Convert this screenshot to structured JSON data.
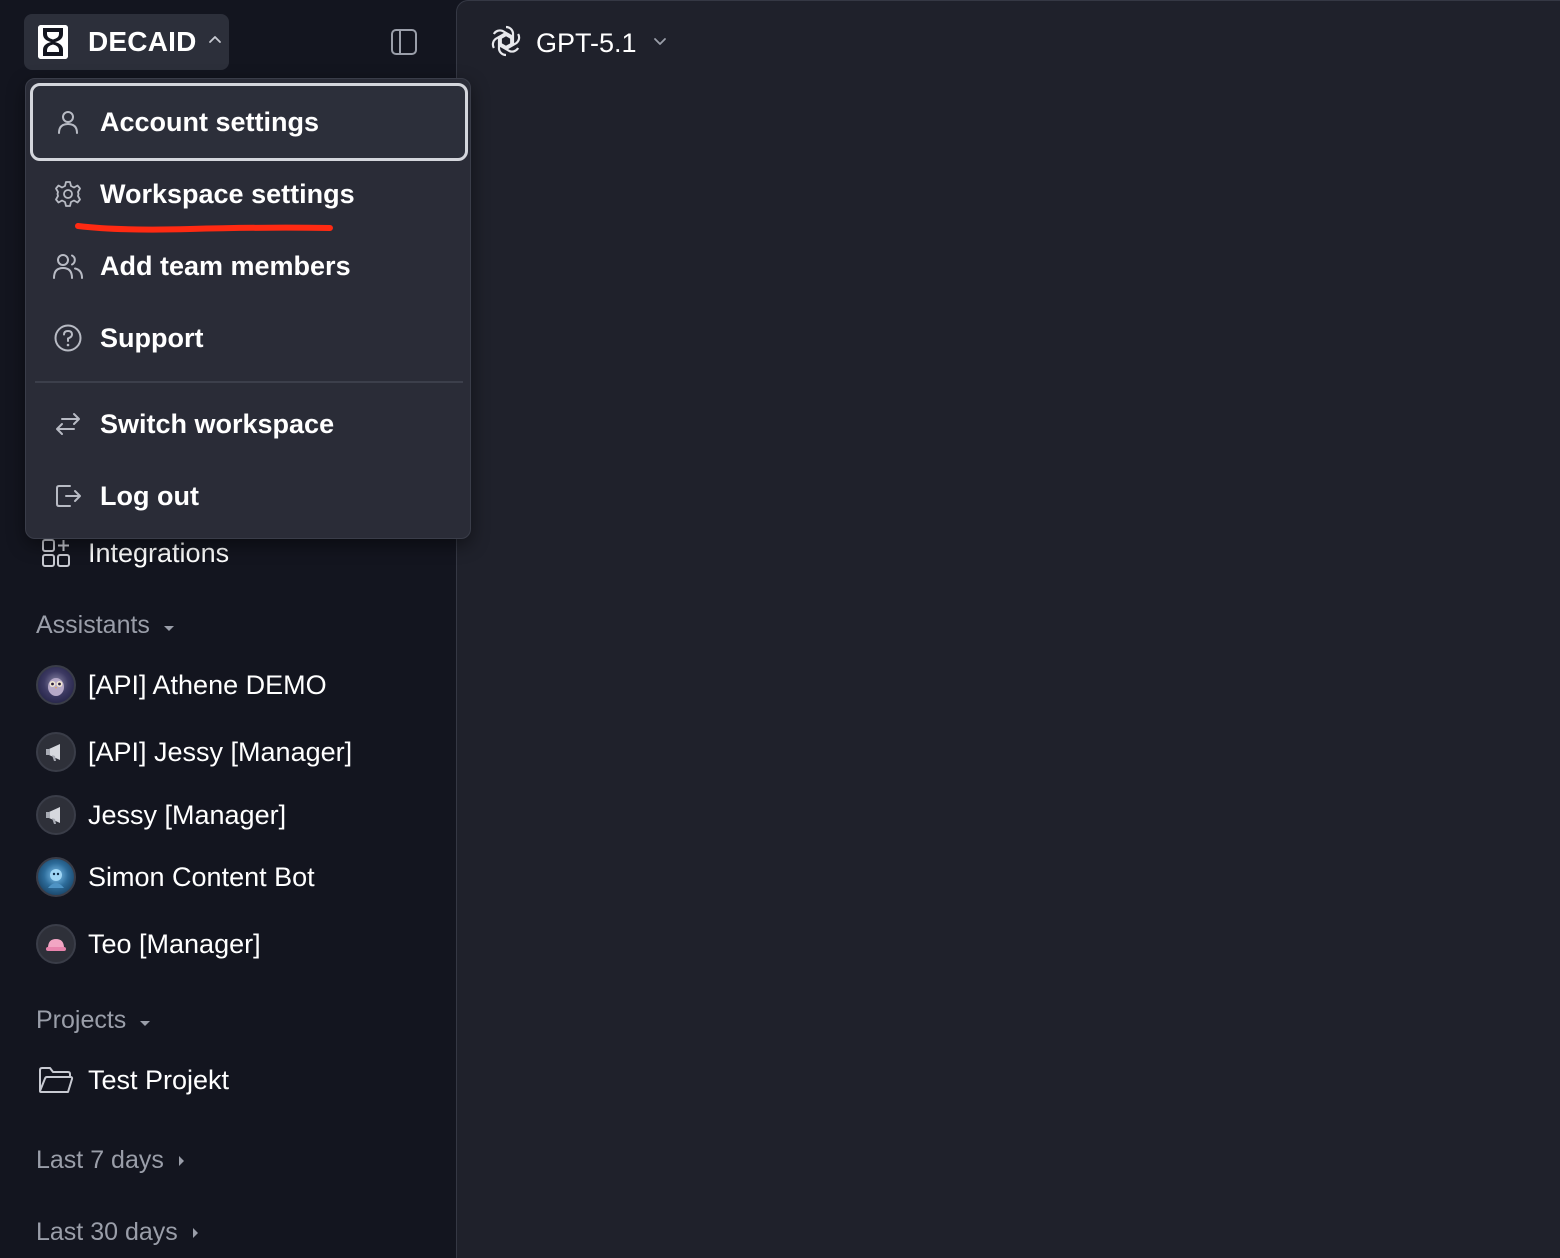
{
  "workspace": {
    "name": "DECAID",
    "logo_icon": "hourglass-logo-icon",
    "chevron_icon": "chevron-up-icon"
  },
  "sidebar": {
    "toggle_icon": "sidebar-panel-icon",
    "integrations_label": "Integrations",
    "assistants": {
      "title": "Assistants",
      "items": [
        {
          "label": "[API] Athene DEMO",
          "avatar": "owl-avatar"
        },
        {
          "label": "[API] Jessy [Manager]",
          "avatar": "megaphone-avatar"
        },
        {
          "label": "Jessy [Manager]",
          "avatar": "megaphone-avatar"
        },
        {
          "label": "Simon Content Bot",
          "avatar": "robot-avatar"
        },
        {
          "label": "Teo [Manager]",
          "avatar": "pink-hat-avatar"
        }
      ]
    },
    "projects": {
      "title": "Projects",
      "items": [
        {
          "label": "Test Projekt",
          "icon": "folder-icon"
        }
      ]
    },
    "history": [
      {
        "label": "Last 7 days"
      },
      {
        "label": "Last 30 days"
      }
    ]
  },
  "menu": {
    "items": [
      {
        "label": "Account settings",
        "icon": "user-icon",
        "focused": true
      },
      {
        "label": "Workspace settings",
        "icon": "gear-icon",
        "annotated": true
      },
      {
        "label": "Add team members",
        "icon": "users-icon"
      },
      {
        "label": "Support",
        "icon": "question-circle-icon"
      },
      {
        "label": "Switch workspace",
        "icon": "switch-arrows-icon"
      },
      {
        "label": "Log out",
        "icon": "logout-icon"
      }
    ],
    "annotation_color": "#ff2a12"
  },
  "model": {
    "name": "GPT-5.1",
    "icon": "openai-logo-icon"
  },
  "colors": {
    "sidebar_bg": "#13151f",
    "main_bg": "#1f212b",
    "menu_bg": "#2a2c37",
    "muted_text": "#9a9ea9"
  }
}
